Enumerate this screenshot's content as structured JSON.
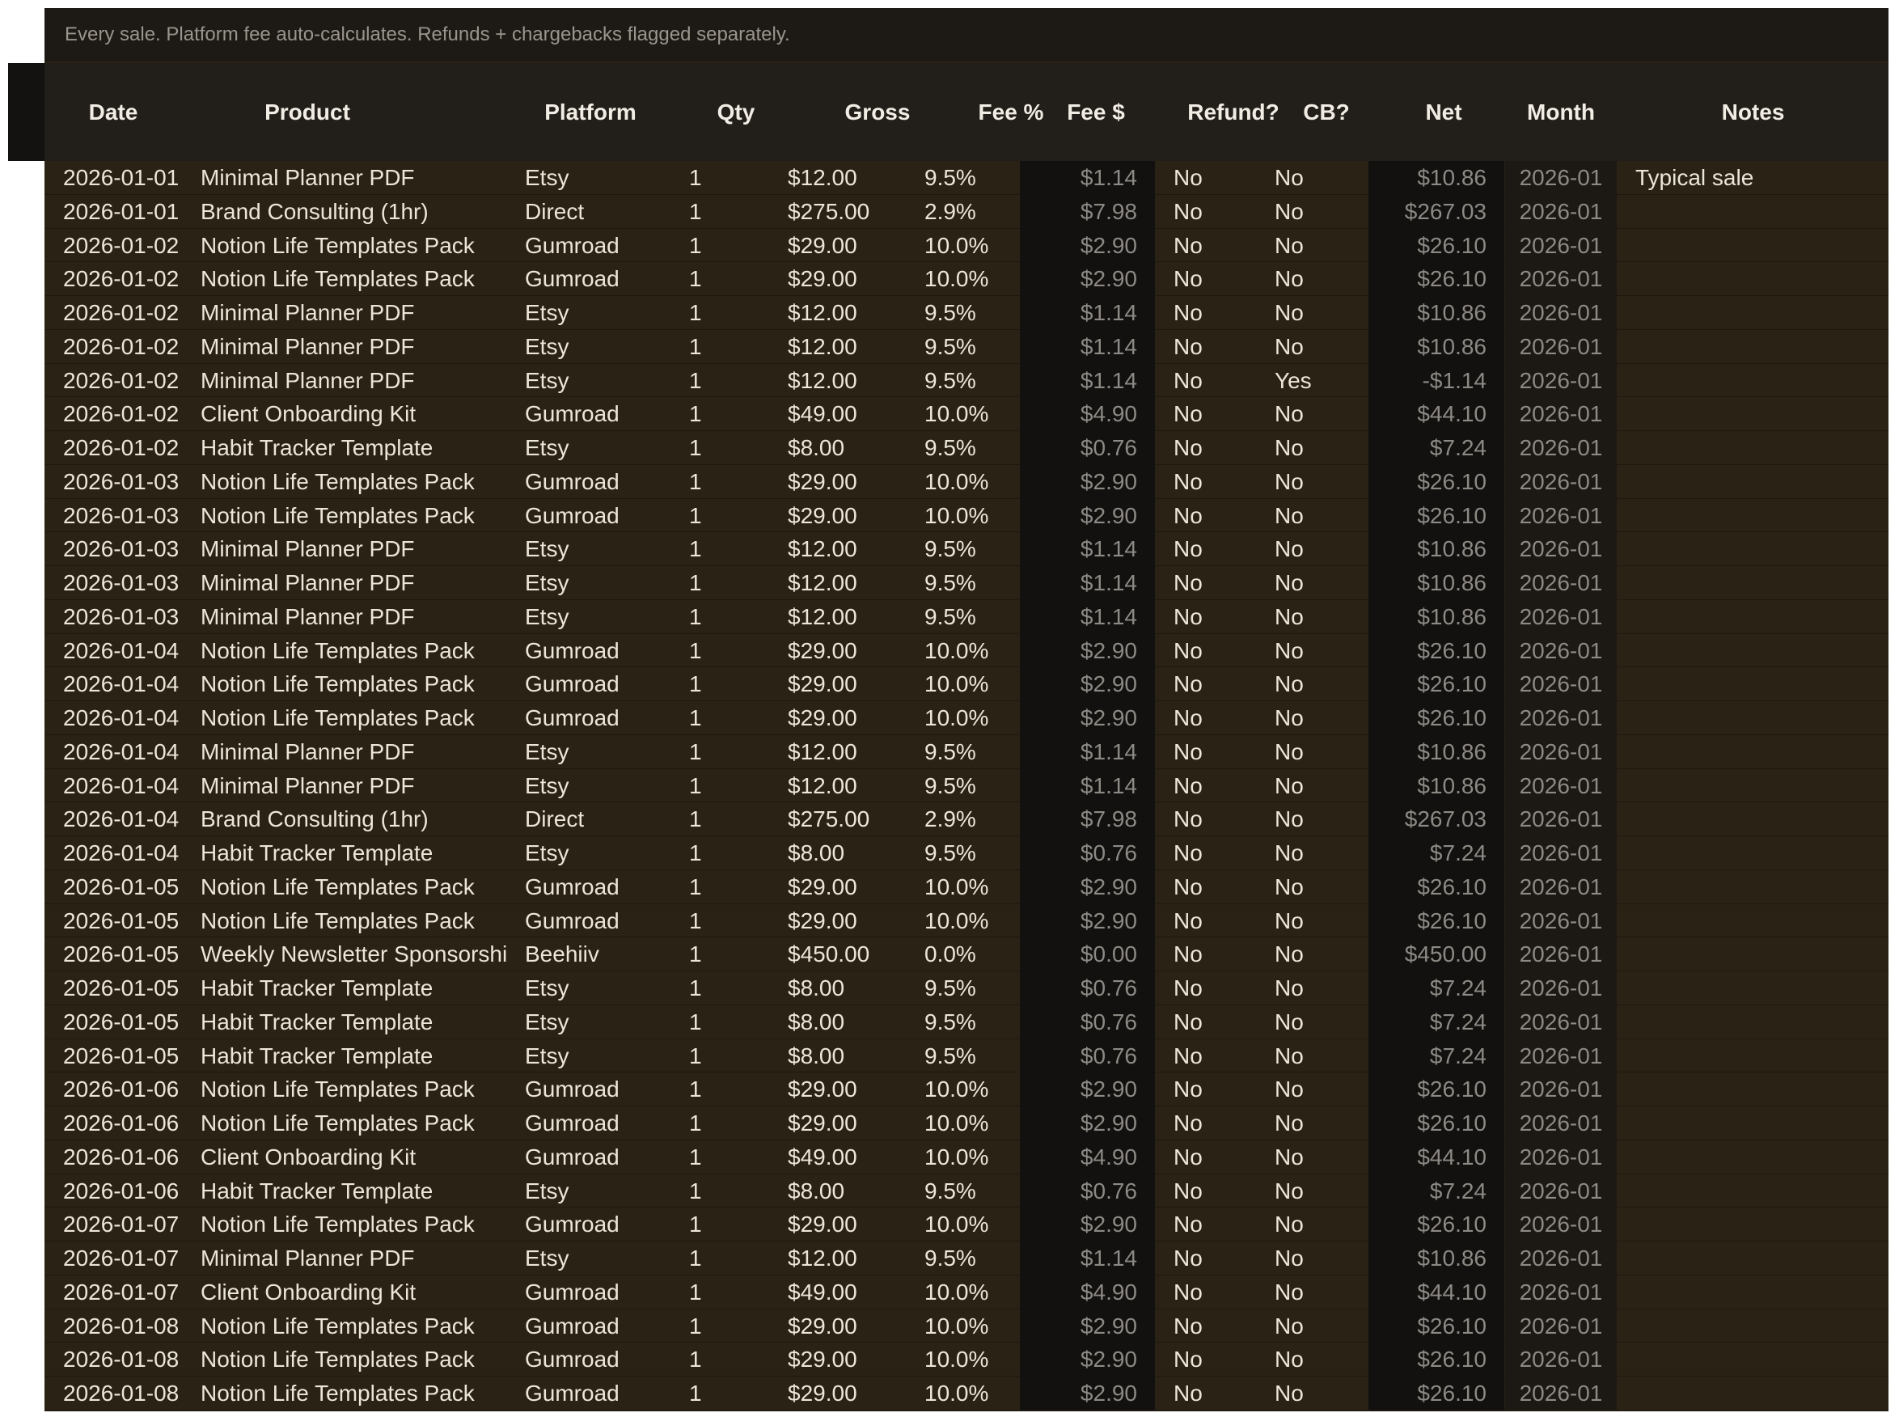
{
  "sheet": {
    "subtitle": "Every sale. Platform fee auto-calculates. Refunds + chargebacks flagged separately.",
    "columns": [
      "Date",
      "Product",
      "Platform",
      "Qty",
      "Gross",
      "Fee %",
      "Fee $",
      "Refund?",
      "CB?",
      "Net",
      "Month",
      "Notes"
    ],
    "rows": [
      [
        "2026-01-01",
        "Minimal Planner PDF",
        "Etsy",
        "1",
        "$12.00",
        "9.5%",
        "$1.14",
        "No",
        "No",
        "$10.86",
        "2026-01",
        "Typical sale"
      ],
      [
        "2026-01-01",
        "Brand Consulting (1hr)",
        "Direct",
        "1",
        "$275.00",
        "2.9%",
        "$7.98",
        "No",
        "No",
        "$267.03",
        "2026-01",
        ""
      ],
      [
        "2026-01-02",
        "Notion Life Templates Pack",
        "Gumroad",
        "1",
        "$29.00",
        "10.0%",
        "$2.90",
        "No",
        "No",
        "$26.10",
        "2026-01",
        ""
      ],
      [
        "2026-01-02",
        "Notion Life Templates Pack",
        "Gumroad",
        "1",
        "$29.00",
        "10.0%",
        "$2.90",
        "No",
        "No",
        "$26.10",
        "2026-01",
        ""
      ],
      [
        "2026-01-02",
        "Minimal Planner PDF",
        "Etsy",
        "1",
        "$12.00",
        "9.5%",
        "$1.14",
        "No",
        "No",
        "$10.86",
        "2026-01",
        ""
      ],
      [
        "2026-01-02",
        "Minimal Planner PDF",
        "Etsy",
        "1",
        "$12.00",
        "9.5%",
        "$1.14",
        "No",
        "No",
        "$10.86",
        "2026-01",
        ""
      ],
      [
        "2026-01-02",
        "Minimal Planner PDF",
        "Etsy",
        "1",
        "$12.00",
        "9.5%",
        "$1.14",
        "No",
        "Yes",
        "-$1.14",
        "2026-01",
        ""
      ],
      [
        "2026-01-02",
        "Client Onboarding Kit",
        "Gumroad",
        "1",
        "$49.00",
        "10.0%",
        "$4.90",
        "No",
        "No",
        "$44.10",
        "2026-01",
        ""
      ],
      [
        "2026-01-02",
        "Habit Tracker Template",
        "Etsy",
        "1",
        "$8.00",
        "9.5%",
        "$0.76",
        "No",
        "No",
        "$7.24",
        "2026-01",
        ""
      ],
      [
        "2026-01-03",
        "Notion Life Templates Pack",
        "Gumroad",
        "1",
        "$29.00",
        "10.0%",
        "$2.90",
        "No",
        "No",
        "$26.10",
        "2026-01",
        ""
      ],
      [
        "2026-01-03",
        "Notion Life Templates Pack",
        "Gumroad",
        "1",
        "$29.00",
        "10.0%",
        "$2.90",
        "No",
        "No",
        "$26.10",
        "2026-01",
        ""
      ],
      [
        "2026-01-03",
        "Minimal Planner PDF",
        "Etsy",
        "1",
        "$12.00",
        "9.5%",
        "$1.14",
        "No",
        "No",
        "$10.86",
        "2026-01",
        ""
      ],
      [
        "2026-01-03",
        "Minimal Planner PDF",
        "Etsy",
        "1",
        "$12.00",
        "9.5%",
        "$1.14",
        "No",
        "No",
        "$10.86",
        "2026-01",
        ""
      ],
      [
        "2026-01-03",
        "Minimal Planner PDF",
        "Etsy",
        "1",
        "$12.00",
        "9.5%",
        "$1.14",
        "No",
        "No",
        "$10.86",
        "2026-01",
        ""
      ],
      [
        "2026-01-04",
        "Notion Life Templates Pack",
        "Gumroad",
        "1",
        "$29.00",
        "10.0%",
        "$2.90",
        "No",
        "No",
        "$26.10",
        "2026-01",
        ""
      ],
      [
        "2026-01-04",
        "Notion Life Templates Pack",
        "Gumroad",
        "1",
        "$29.00",
        "10.0%",
        "$2.90",
        "No",
        "No",
        "$26.10",
        "2026-01",
        ""
      ],
      [
        "2026-01-04",
        "Notion Life Templates Pack",
        "Gumroad",
        "1",
        "$29.00",
        "10.0%",
        "$2.90",
        "No",
        "No",
        "$26.10",
        "2026-01",
        ""
      ],
      [
        "2026-01-04",
        "Minimal Planner PDF",
        "Etsy",
        "1",
        "$12.00",
        "9.5%",
        "$1.14",
        "No",
        "No",
        "$10.86",
        "2026-01",
        ""
      ],
      [
        "2026-01-04",
        "Minimal Planner PDF",
        "Etsy",
        "1",
        "$12.00",
        "9.5%",
        "$1.14",
        "No",
        "No",
        "$10.86",
        "2026-01",
        ""
      ],
      [
        "2026-01-04",
        "Brand Consulting (1hr)",
        "Direct",
        "1",
        "$275.00",
        "2.9%",
        "$7.98",
        "No",
        "No",
        "$267.03",
        "2026-01",
        ""
      ],
      [
        "2026-01-04",
        "Habit Tracker Template",
        "Etsy",
        "1",
        "$8.00",
        "9.5%",
        "$0.76",
        "No",
        "No",
        "$7.24",
        "2026-01",
        ""
      ],
      [
        "2026-01-05",
        "Notion Life Templates Pack",
        "Gumroad",
        "1",
        "$29.00",
        "10.0%",
        "$2.90",
        "No",
        "No",
        "$26.10",
        "2026-01",
        ""
      ],
      [
        "2026-01-05",
        "Notion Life Templates Pack",
        "Gumroad",
        "1",
        "$29.00",
        "10.0%",
        "$2.90",
        "No",
        "No",
        "$26.10",
        "2026-01",
        ""
      ],
      [
        "2026-01-05",
        "Weekly Newsletter Sponsorshi",
        "Beehiiv",
        "1",
        "$450.00",
        "0.0%",
        "$0.00",
        "No",
        "No",
        "$450.00",
        "2026-01",
        ""
      ],
      [
        "2026-01-05",
        "Habit Tracker Template",
        "Etsy",
        "1",
        "$8.00",
        "9.5%",
        "$0.76",
        "No",
        "No",
        "$7.24",
        "2026-01",
        ""
      ],
      [
        "2026-01-05",
        "Habit Tracker Template",
        "Etsy",
        "1",
        "$8.00",
        "9.5%",
        "$0.76",
        "No",
        "No",
        "$7.24",
        "2026-01",
        ""
      ],
      [
        "2026-01-05",
        "Habit Tracker Template",
        "Etsy",
        "1",
        "$8.00",
        "9.5%",
        "$0.76",
        "No",
        "No",
        "$7.24",
        "2026-01",
        ""
      ],
      [
        "2026-01-06",
        "Notion Life Templates Pack",
        "Gumroad",
        "1",
        "$29.00",
        "10.0%",
        "$2.90",
        "No",
        "No",
        "$26.10",
        "2026-01",
        ""
      ],
      [
        "2026-01-06",
        "Notion Life Templates Pack",
        "Gumroad",
        "1",
        "$29.00",
        "10.0%",
        "$2.90",
        "No",
        "No",
        "$26.10",
        "2026-01",
        ""
      ],
      [
        "2026-01-06",
        "Client Onboarding Kit",
        "Gumroad",
        "1",
        "$49.00",
        "10.0%",
        "$4.90",
        "No",
        "No",
        "$44.10",
        "2026-01",
        ""
      ],
      [
        "2026-01-06",
        "Habit Tracker Template",
        "Etsy",
        "1",
        "$8.00",
        "9.5%",
        "$0.76",
        "No",
        "No",
        "$7.24",
        "2026-01",
        ""
      ],
      [
        "2026-01-07",
        "Notion Life Templates Pack",
        "Gumroad",
        "1",
        "$29.00",
        "10.0%",
        "$2.90",
        "No",
        "No",
        "$26.10",
        "2026-01",
        ""
      ],
      [
        "2026-01-07",
        "Minimal Planner PDF",
        "Etsy",
        "1",
        "$12.00",
        "9.5%",
        "$1.14",
        "No",
        "No",
        "$10.86",
        "2026-01",
        ""
      ],
      [
        "2026-01-07",
        "Client Onboarding Kit",
        "Gumroad",
        "1",
        "$49.00",
        "10.0%",
        "$4.90",
        "No",
        "No",
        "$44.10",
        "2026-01",
        ""
      ],
      [
        "2026-01-08",
        "Notion Life Templates Pack",
        "Gumroad",
        "1",
        "$29.00",
        "10.0%",
        "$2.90",
        "No",
        "No",
        "$26.10",
        "2026-01",
        ""
      ],
      [
        "2026-01-08",
        "Notion Life Templates Pack",
        "Gumroad",
        "1",
        "$29.00",
        "10.0%",
        "$2.90",
        "No",
        "No",
        "$26.10",
        "2026-01",
        ""
      ],
      [
        "2026-01-08",
        "Notion Life Templates Pack",
        "Gumroad",
        "1",
        "$29.00",
        "10.0%",
        "$2.90",
        "No",
        "No",
        "$26.10",
        "2026-01",
        ""
      ]
    ]
  }
}
